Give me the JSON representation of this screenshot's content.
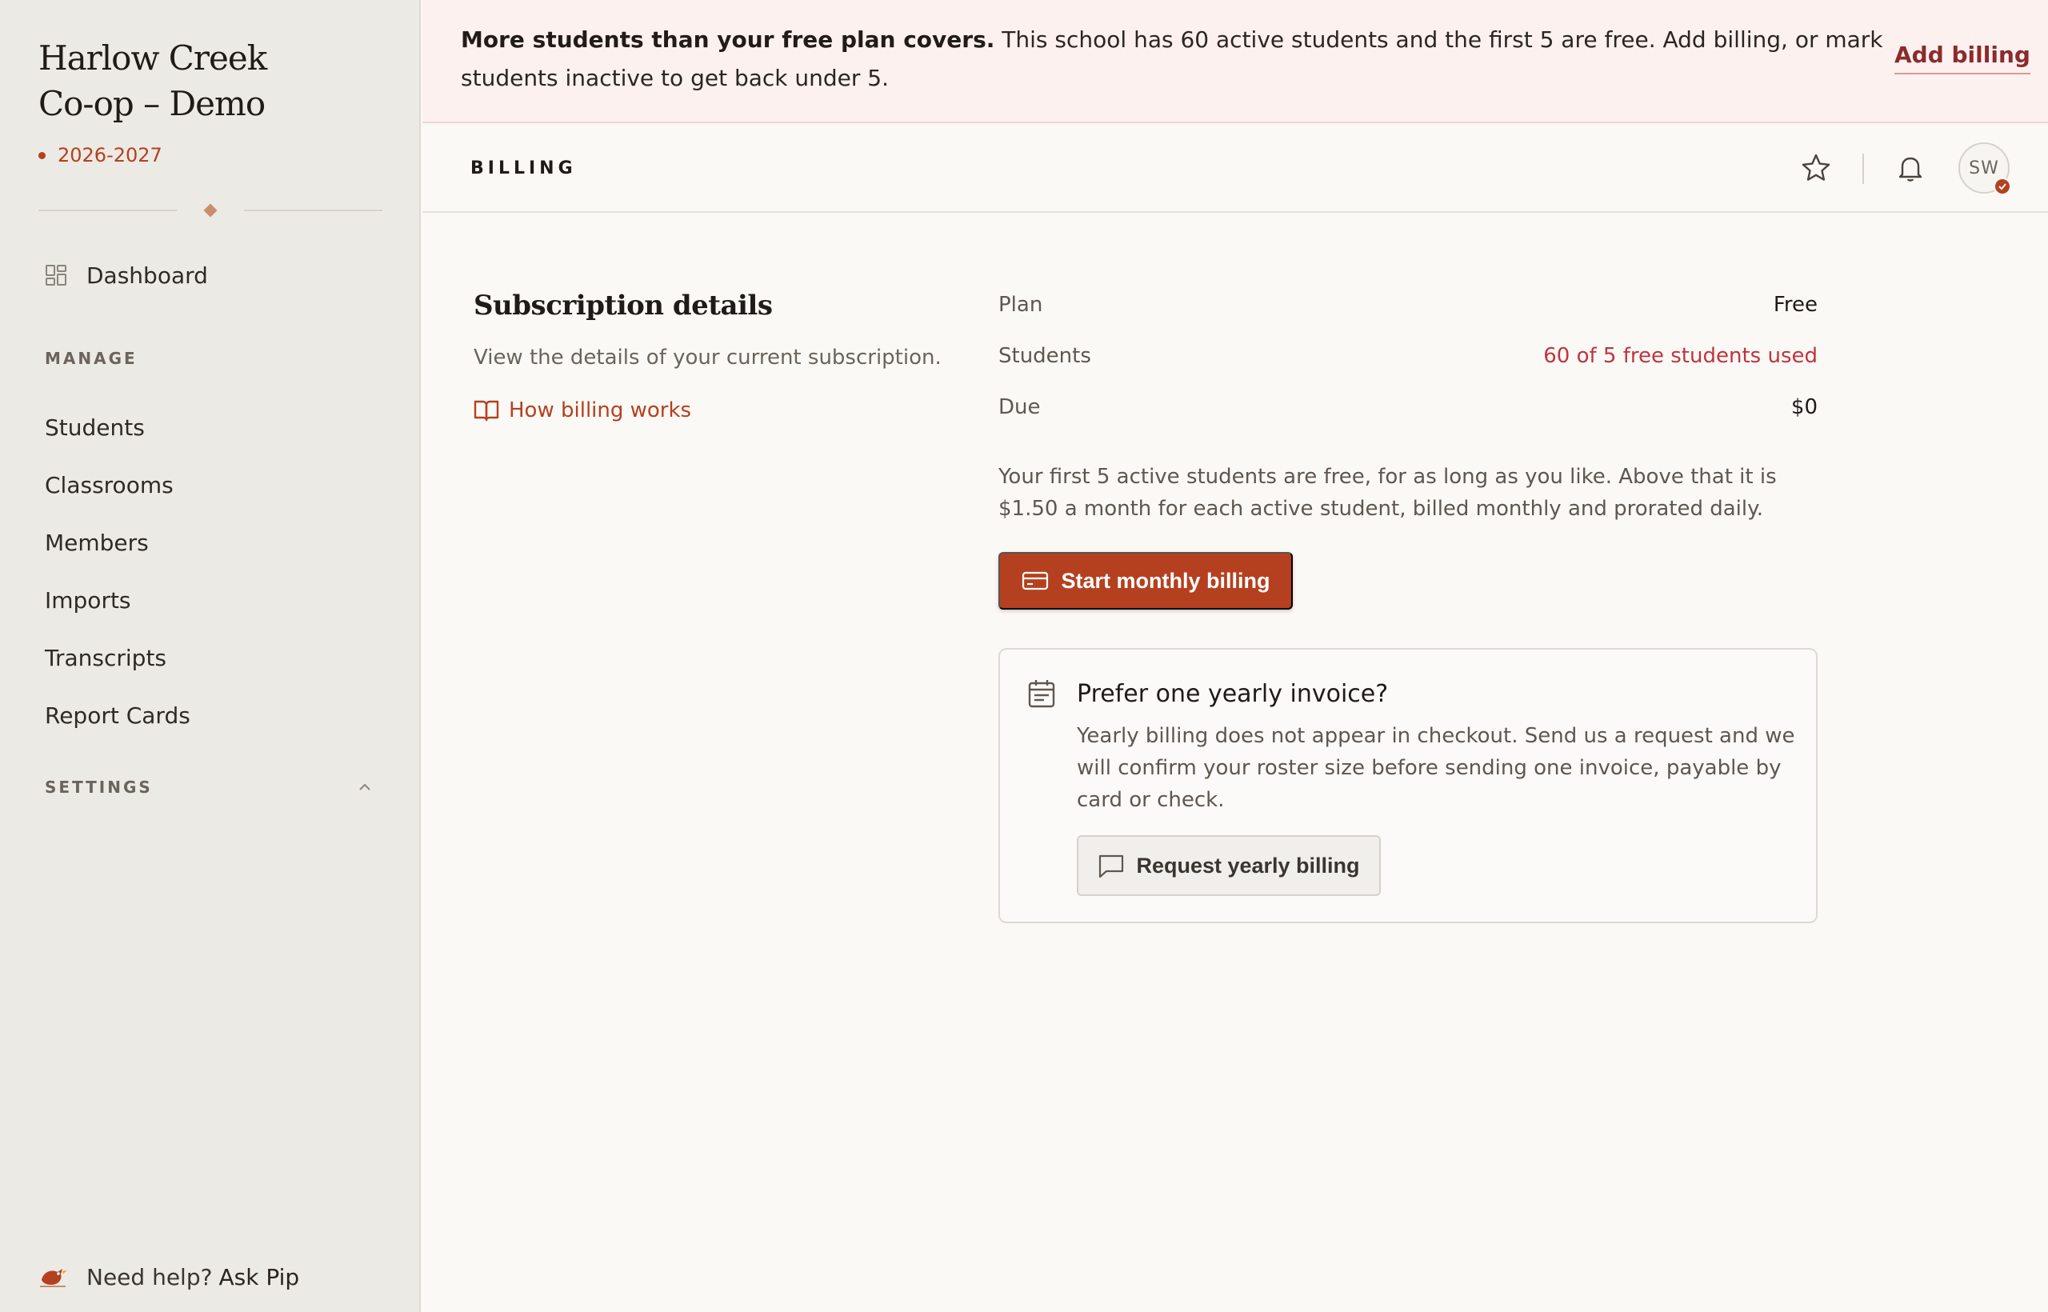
{
  "sidebar": {
    "school_name_line1": "Harlow Creek",
    "school_name_line2": "Co-op – Demo",
    "school_year": "2026-2027",
    "dashboard_label": "Dashboard",
    "manage_label": "MANAGE",
    "manage_items": [
      "Students",
      "Classrooms",
      "Members",
      "Imports",
      "Transcripts",
      "Report Cards"
    ],
    "settings_label": "SETTINGS",
    "help_text": "Need help?",
    "help_link": "Ask Pip"
  },
  "banner": {
    "bold": "More students than your free plan covers.",
    "text": " This school has 60 active students and the first 5 are free. Add billing, or mark students inactive to get back under 5.",
    "action": "Add billing"
  },
  "header": {
    "title": "BILLING",
    "avatar_initials": "SW"
  },
  "subscription": {
    "title": "Subscription details",
    "description": "View the details of your current subscription.",
    "help_link": "How billing works",
    "rows": [
      {
        "label": "Plan",
        "value": "Free"
      },
      {
        "label": "Students",
        "value": "60 of 5 free students used"
      },
      {
        "label": "Due",
        "value": "$0"
      }
    ],
    "pricing_text": "Your first 5 active students are free, for as long as you like. Above that it is $1.50 a month for each active student, billed monthly and prorated daily.",
    "primary_button": "Start monthly billing"
  },
  "yearly": {
    "title": "Prefer one yearly invoice?",
    "body": "Yearly billing does not appear in checkout. Send us a request and we will confirm your roster size before sending one invoice, payable by card or check.",
    "button": "Request yearly billing"
  },
  "colors": {
    "accent": "#b5401f",
    "alert_text": "#c0343f",
    "banner_bg": "#fdf1f0",
    "sidebar_bg": "#eceae5",
    "page_bg": "#faf9f6"
  },
  "icons": {
    "dashboard": "grid-icon",
    "help": "bird-icon",
    "favorite": "star-icon",
    "notifications": "bell-icon",
    "docs": "book-open-icon",
    "payment": "credit-card-icon",
    "yearly": "calendar-icon",
    "request": "message-square-icon"
  }
}
